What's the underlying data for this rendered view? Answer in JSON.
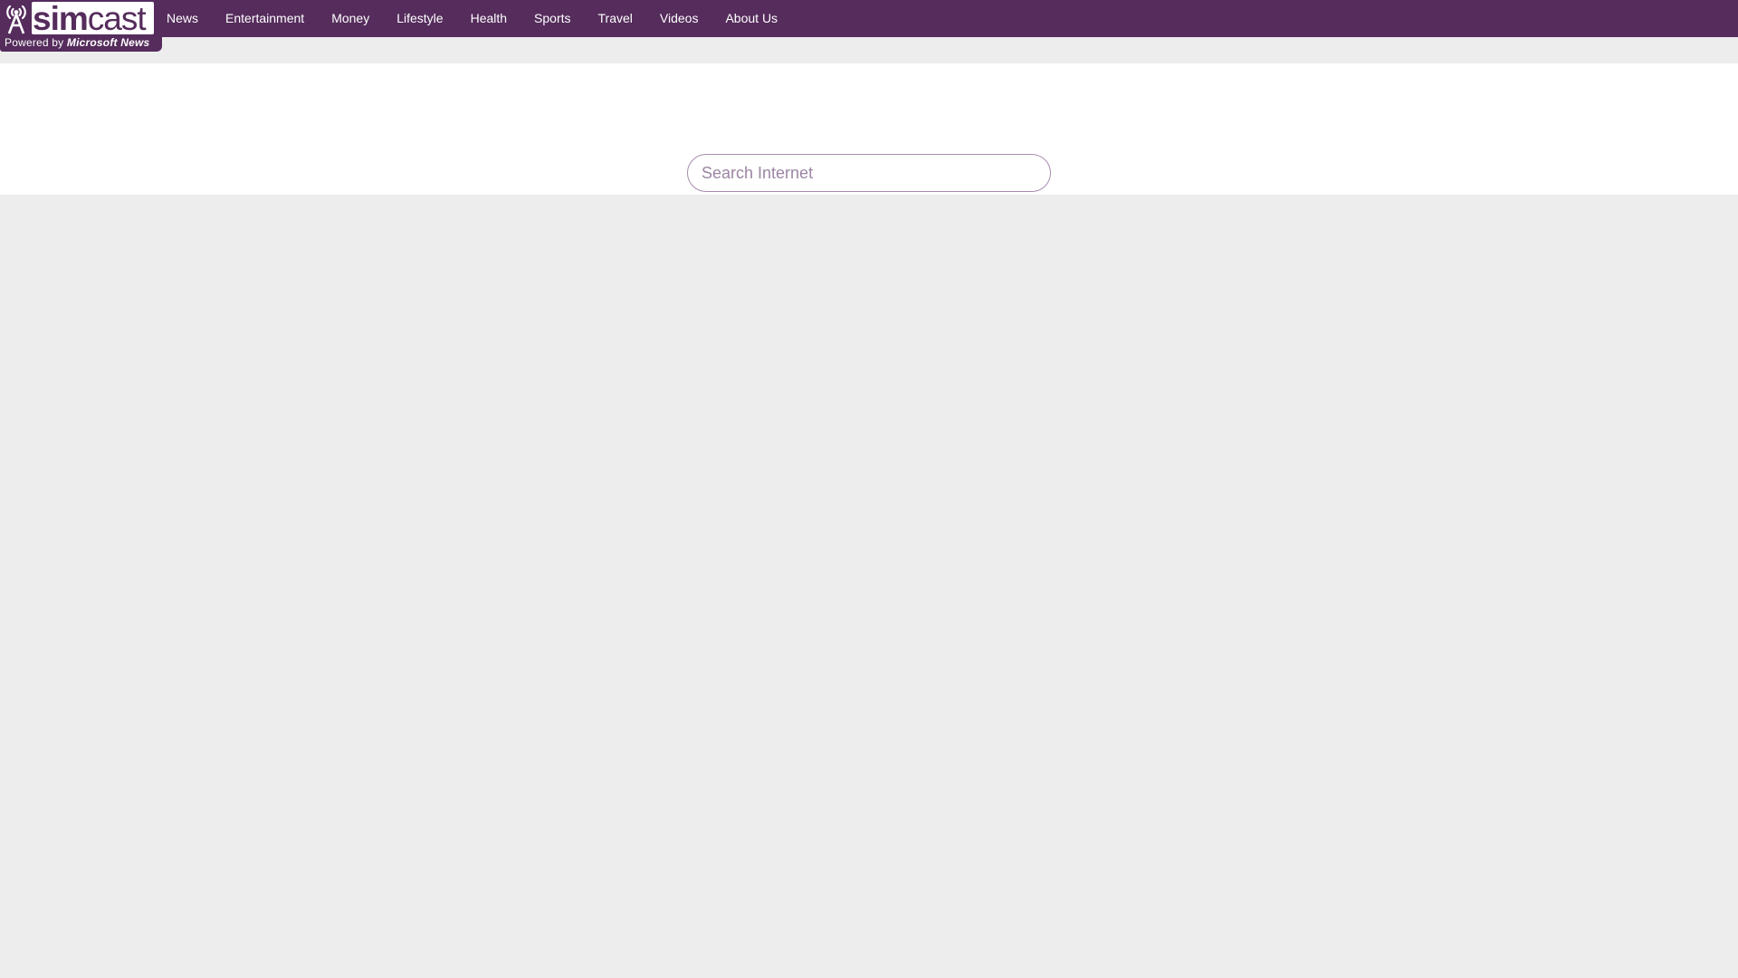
{
  "brand": {
    "logo_primary": "sim",
    "logo_secondary": "cast",
    "powered_prefix": "Powered by",
    "powered_brand": "Microsoft News",
    "icon": "radio-tower-icon",
    "color": "#552c5c"
  },
  "nav": {
    "items": [
      {
        "label": "News"
      },
      {
        "label": "Entertainment"
      },
      {
        "label": "Money"
      },
      {
        "label": "Lifestyle"
      },
      {
        "label": "Health"
      },
      {
        "label": "Sports"
      },
      {
        "label": "Travel"
      },
      {
        "label": "Videos"
      },
      {
        "label": "About Us"
      }
    ]
  },
  "search": {
    "placeholder": "Search Internet",
    "value": ""
  },
  "colors": {
    "nav_bg": "#552c5c",
    "page_bg": "#ededed",
    "band_bg": "#ffffff"
  }
}
